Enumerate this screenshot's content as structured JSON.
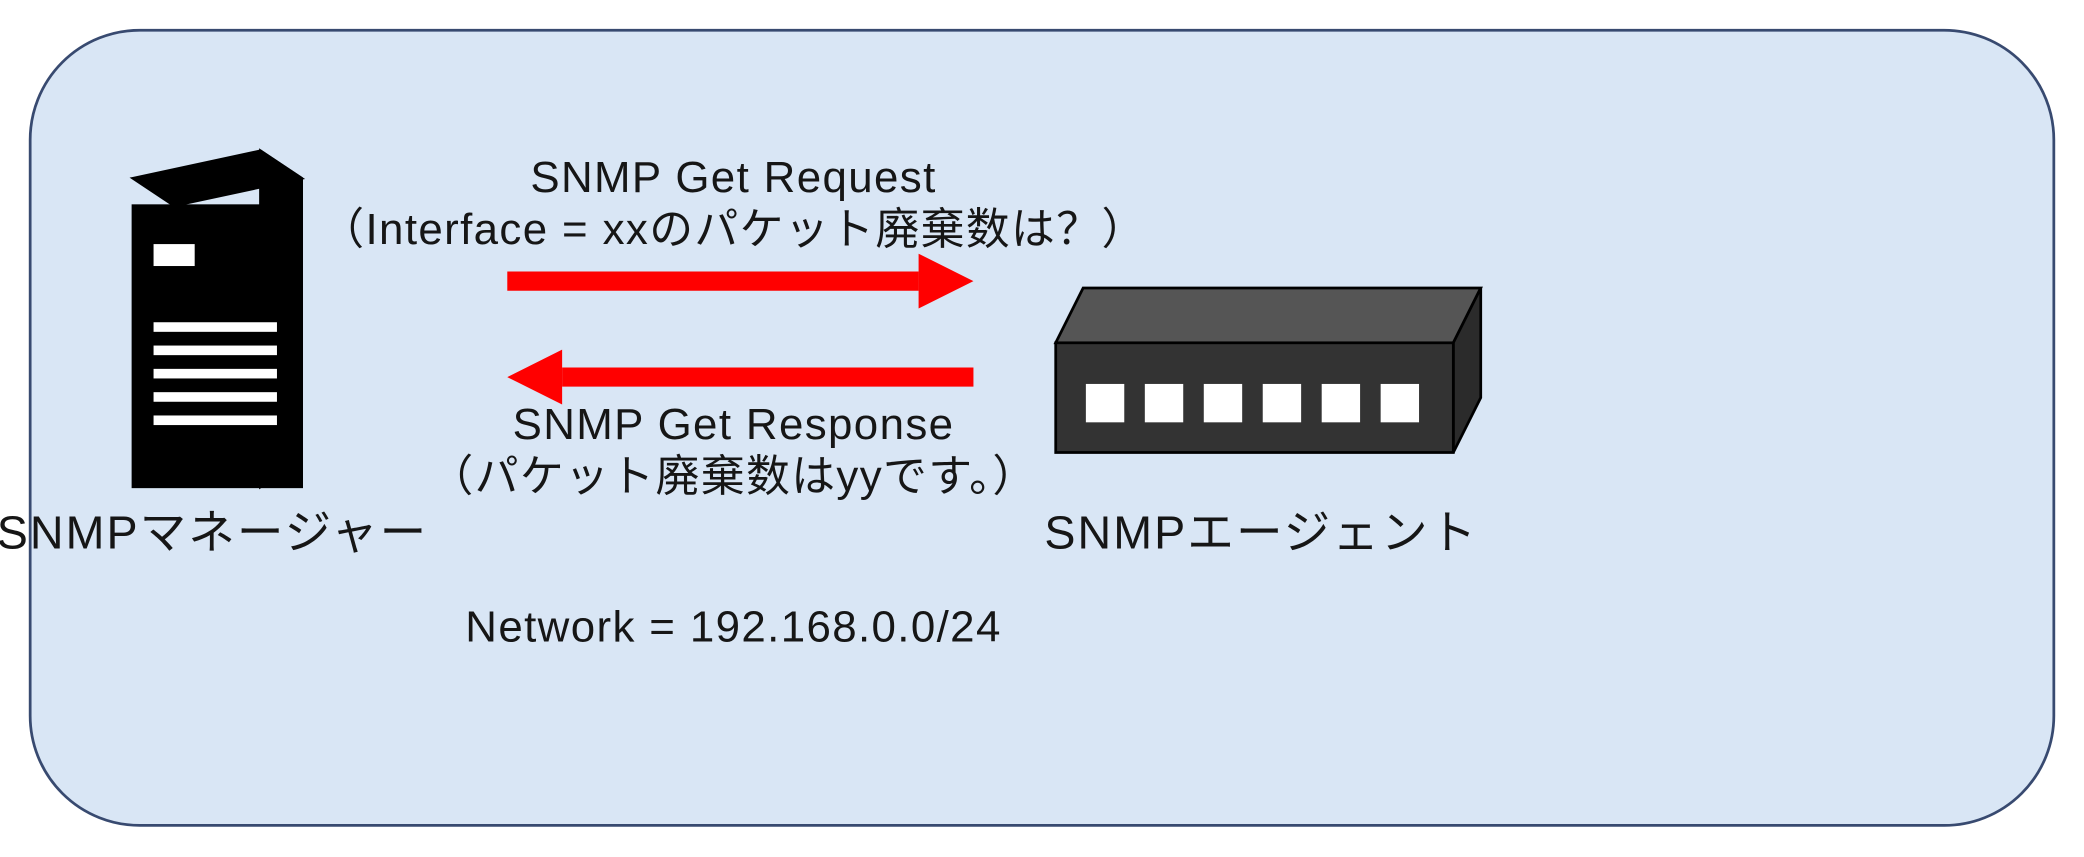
{
  "diagram": {
    "network_label": "Network = 192.168.0.0/24",
    "manager": {
      "label": "SNMPマネージャー"
    },
    "agent": {
      "label": "SNMPエージェント"
    },
    "request": {
      "title": "SNMP Get Request",
      "detail": "（Interface = xxのパケット廃棄数は？）"
    },
    "response": {
      "title": "SNMP Get Response",
      "detail": "（パケット廃棄数はyyです。）"
    }
  }
}
